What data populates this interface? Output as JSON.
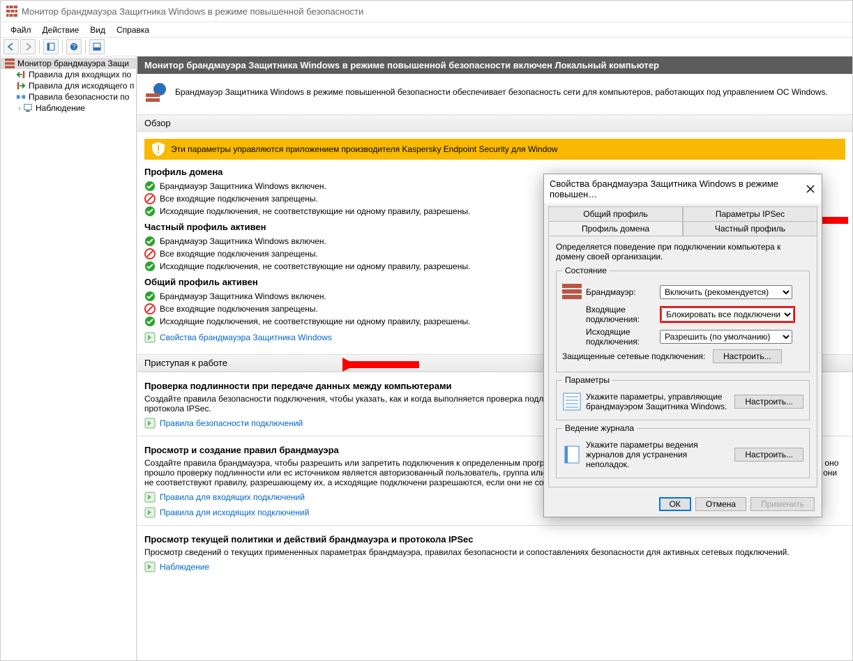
{
  "title": "Монитор брандмауэра Защитника Windows в режиме повышенной безопасности",
  "menubar": [
    "Файл",
    "Действие",
    "Вид",
    "Справка"
  ],
  "tree": {
    "root": "Монитор брандмауэра Защи",
    "children": [
      "Правила для входящих по",
      "Правила для исходящего п",
      "Правила безопасности по",
      "Наблюдение"
    ]
  },
  "header": "Монитор брандмауэра Защитника Windows в режиме повышенной безопасности включен Локальный компьютер",
  "intro": "Брандмауэр Защитника Windows в режиме повышенной безопасности обеспечивает безопасность сети для компьютеров, работающих под управлением ОС Windows.",
  "overview_title": "Обзор",
  "warning": "Эти параметры управляются приложением производителя Kaspersky Endpoint Security для Window",
  "profiles": [
    {
      "title": "Профиль домена",
      "rows": [
        {
          "icon": "ok",
          "text": "Брандмауэр Защитника Windows включен."
        },
        {
          "icon": "block",
          "text": "Все входящие подключения запрещены."
        },
        {
          "icon": "ok",
          "text": "Исходящие подключения, не соответствующие ни одному правилу, разрешены."
        }
      ]
    },
    {
      "title": "Частный профиль активен",
      "rows": [
        {
          "icon": "ok",
          "text": "Брандмауэр Защитника Windows включен."
        },
        {
          "icon": "block",
          "text": "Все входящие подключения запрещены."
        },
        {
          "icon": "ok",
          "text": "Исходящие подключения, не соответствующие ни одному правилу, разрешены."
        }
      ]
    },
    {
      "title": "Общий профиль активен",
      "rows": [
        {
          "icon": "ok",
          "text": "Брандмауэр Защитника Windows включен."
        },
        {
          "icon": "block",
          "text": "Все входящие подключения запрещены."
        },
        {
          "icon": "ok",
          "text": "Исходящие подключения, не соответствующие ни одному правилу, разрешены."
        }
      ]
    }
  ],
  "props_link": "Свойства брандмауэра Защитника Windows",
  "getstarted_title": "Приступая к работе",
  "gs_sections": [
    {
      "heading": "Проверка подлинности при передаче данных между компьютерами",
      "desc": "Создайте правила безопасности подключения, чтобы указать, как и когда выполняется проверка подлинности подключений между компьютерами и их защита с помощью протокола IPSec.",
      "links": [
        "Правила безопасности подключений"
      ]
    },
    {
      "heading": "Просмотр и создание правил брандмауэра",
      "desc": "Создайте правила брандмауэра, чтобы разрешить или запретить подключения к определенным программам или портам. Также можно разрешить подключение, только если оно прошло проверку подлинности или ес источником является авторизованный пользователь, группа или компьютер. По умолчанию входящие подключения блокируются, если они не соответствуют правилу, разрешающему их, а исходящие подключени разрешаются, если они не соответствуют правилу, которое их блокирует.",
      "links": [
        "Правила для входящих подключений",
        "Правила для исходящих подключений"
      ]
    },
    {
      "heading": "Просмотр текущей политики и действий брандмауэра и протокола IPSec",
      "desc": "Просмотр сведений о текущих примененных параметрах брандмауэра, правилах безопасности и сопоставлениях безопасности для активных сетевых подключений.",
      "links": [
        "Наблюдение"
      ]
    }
  ],
  "dialog": {
    "title": "Свойства брандмауэра Защитника Windows в режиме повышен…",
    "tabs_top": [
      "Общий профиль",
      "Параметры IPSec"
    ],
    "tabs_bottom": [
      "Профиль домена",
      "Частный профиль"
    ],
    "desc": "Определяется поведение при подключении компьютера к домену своей организации.",
    "state_legend": "Состояние",
    "firewall_label": "Брандмауэр:",
    "firewall_value": "Включить (рекомендуется)",
    "incoming_label": "Входящие подключения:",
    "incoming_value": "Блокировать все подключения",
    "outgoing_label": "Исходящие подключения:",
    "outgoing_value": "Разрешить (по умолчанию)",
    "protected_label": "Защищенные сетевые подключения:",
    "configure": "Настроить...",
    "params_legend": "Параметры",
    "params_desc": "Укажите параметры, управляющие брандмауэром Защитника Windows.",
    "log_legend": "Ведение журнала",
    "log_desc": "Укажите параметры ведения журналов для устранения неполадок.",
    "ok": "ОК",
    "cancel": "Отмена",
    "apply": "Применить"
  }
}
